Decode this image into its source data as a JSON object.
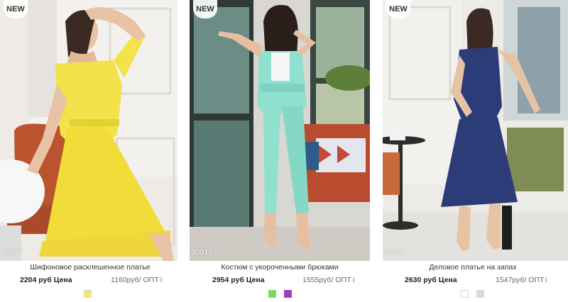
{
  "products": [
    {
      "badge": "NEW",
      "sku": "30777",
      "name": "Шифоновое расклешенное платье",
      "price": "2204 руб Цена",
      "opt": "1160руб/ ОПТ",
      "info": "i",
      "swatches": [
        "#f6e86b"
      ]
    },
    {
      "badge": "NEW",
      "sku": "30915",
      "name": "Костюм с укороченными брюками",
      "price": "2954 руб Цена",
      "opt": "1555руб/ ОПТ",
      "info": "i",
      "swatches": [
        "#7ed96b",
        "#9b3fc9"
      ]
    },
    {
      "badge": "NEW",
      "sku": "30754",
      "name": "Деловое платье на запах",
      "price": "2630 руб Цена",
      "opt": "1547руб/ ОПТ",
      "info": "i",
      "swatches": [
        "#ffffff",
        "#e8d8cc"
      ]
    }
  ],
  "colors": {
    "dress1": "#f4e24a",
    "suit": "#8fe0cf",
    "dress3": "#2c3c78"
  }
}
